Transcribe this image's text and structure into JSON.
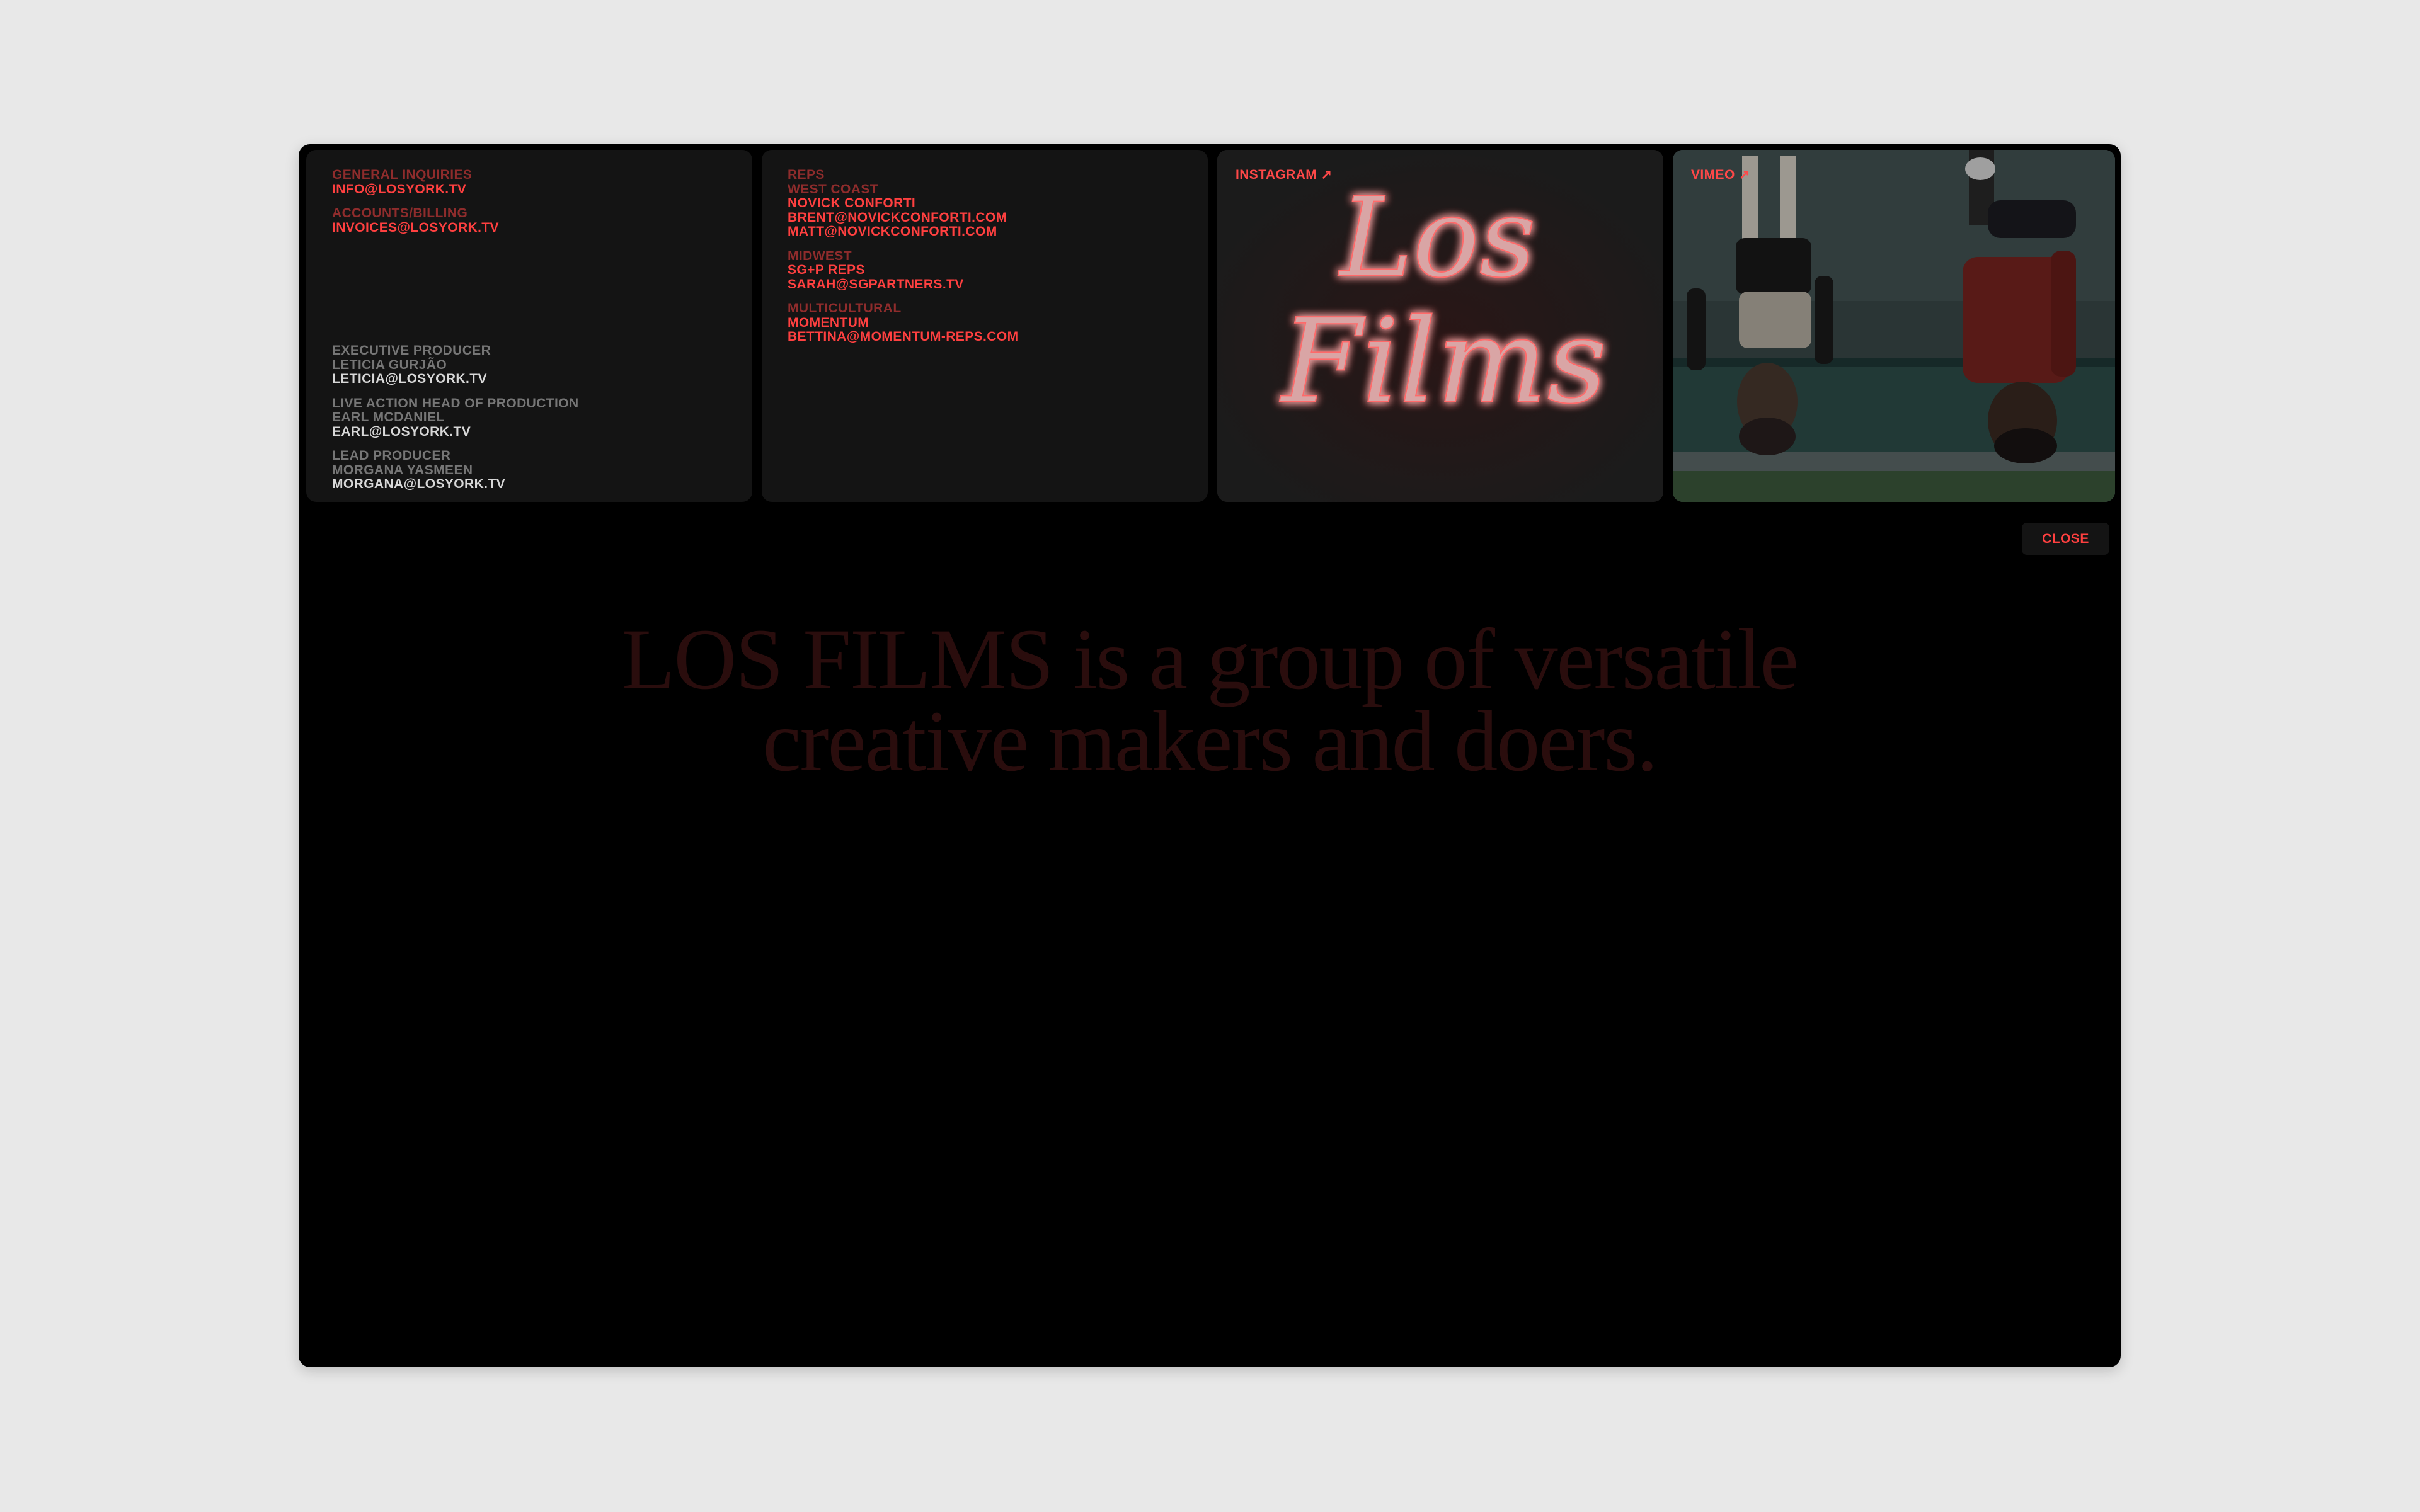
{
  "contact": {
    "general_label": "GENERAL INQUIRIES",
    "general_email": "INFO@LOSYORK.TV",
    "billing_label": "ACCOUNTS/BILLING",
    "billing_email": "INVOICES@LOSYORK.TV",
    "staff": [
      {
        "role": "EXECUTIVE PRODUCER",
        "name": "LETICIA GURJÃO",
        "email": "LETICIA@LOSYORK.TV"
      },
      {
        "role": "LIVE ACTION HEAD OF PRODUCTION",
        "name": "EARL MCDANIEL",
        "email": "EARL@LOSYORK.TV"
      },
      {
        "role": "LEAD PRODUCER",
        "name": "MORGANA YASMEEN",
        "email": "MORGANA@LOSYORK.TV"
      }
    ]
  },
  "reps": {
    "title": "REPS",
    "regions": [
      {
        "region": "WEST COAST",
        "company": "NOVICK CONFORTI",
        "emails": [
          "BRENT@NOVICKCONFORTI.COM",
          "MATT@NOVICKCONFORTI.COM"
        ]
      },
      {
        "region": "MIDWEST",
        "company": "SG+P REPS",
        "emails": [
          "SARAH@SGPARTNERS.TV"
        ]
      },
      {
        "region": "MULTICULTURAL",
        "company": "MOMENTUM",
        "emails": [
          "BETTINA@MOMENTUM-REPS.COM"
        ]
      }
    ]
  },
  "instagram": {
    "label": "INSTAGRAM ↗",
    "neon_line1": "Los",
    "neon_line2": "Films"
  },
  "vimeo": {
    "label": "VIMEO ↗"
  },
  "close_label": "CLOSE",
  "tagline": {
    "line1": "LOS FILMS is a group of versatile",
    "line2": "creative makers and doers."
  },
  "colors": {
    "accent": "#ff4040",
    "window_bg": "#000000",
    "card_bg": "#141414",
    "page_bg": "#e8e8e8"
  }
}
